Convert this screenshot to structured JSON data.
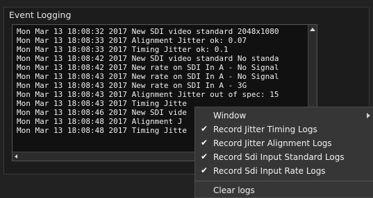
{
  "panel": {
    "title": "Event Logging"
  },
  "log": {
    "lines": [
      "Mon Mar 13 18:08:32 2017 New SDI video standard 2048x1080",
      "Mon Mar 13 18:08:33 2017 Alignment Jitter ok: 0.07",
      "Mon Mar 13 18:08:33 2017 Timing Jitter ok: 0.1",
      "Mon Mar 13 18:08:42 2017 New SDI video standard No standa",
      "Mon Mar 13 18:08:42 2017 New rate on SDI In A - No Signal",
      "Mon Mar 13 18:08:43 2017 New rate on SDI In A - No Signal",
      "Mon Mar 13 18:08:43 2017 New rate on SDI In A - 3G",
      "Mon Mar 13 18:08:43 2017 Alignment Jitter out of spec: 15",
      "Mon Mar 13 18:08:43 2017 Timing Jitte",
      "Mon Mar 13 18:08:46 2017 New SDI vide",
      "Mon Mar 13 18:08:48 2017 Alignment J",
      "Mon Mar 13 18:08:48 2017 Timing Jitte"
    ]
  },
  "context_menu": {
    "window_label": "Window",
    "items": [
      {
        "label": "Record Jitter Timing Logs",
        "checked": true,
        "check_glyph": "✔"
      },
      {
        "label": "Record Jitter Alignment Logs",
        "checked": true,
        "check_glyph": "✔"
      },
      {
        "label": "Record Sdi Input Standard Logs",
        "checked": true,
        "check_glyph": "✔"
      },
      {
        "label": "Record Sdi Input Rate Logs",
        "checked": true,
        "check_glyph": "✔"
      }
    ],
    "clear_label": "Clear logs"
  }
}
